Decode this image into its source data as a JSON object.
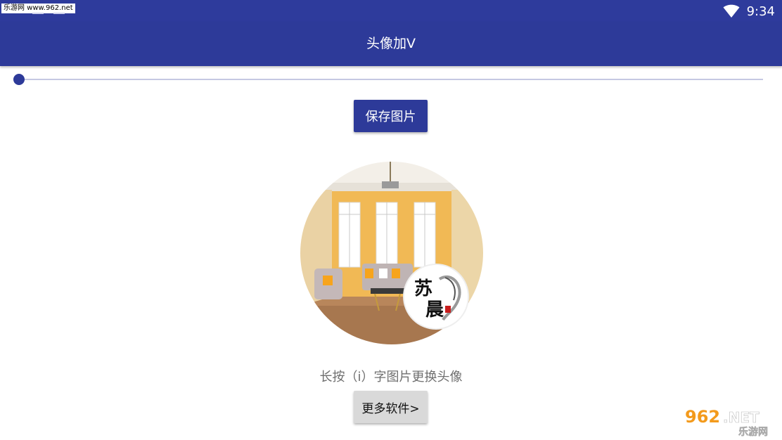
{
  "status_bar": {
    "watermark": "乐游网 www.962.net",
    "time": "9:34",
    "wifi_icon": "wifi-icon",
    "color": "#2e3b9c"
  },
  "app_bar": {
    "title": "头像加V",
    "color": "#2d3a99"
  },
  "slider": {
    "value": 0,
    "accent": "#2d3a99"
  },
  "save_button": {
    "label": "保存图片"
  },
  "avatar": {
    "description_icon": "avatar-living-room-image",
    "badge_text_top": "苏",
    "badge_text_bottom": "晨"
  },
  "hint": {
    "text": "长按（i）字图片更换头像"
  },
  "more_button": {
    "label": "更多软件>"
  },
  "brand": {
    "number": "962",
    "suffix": ".NET",
    "subtitle": "乐游网"
  }
}
